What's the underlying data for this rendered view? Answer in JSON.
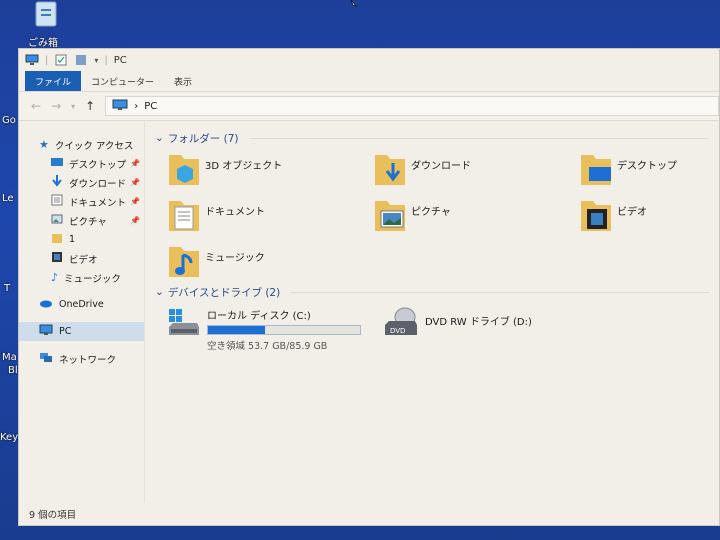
{
  "desktop": {
    "recycle_label": "ごみ箱",
    "side_labels": [
      "Go",
      "Le",
      "T",
      "Ma",
      "Bl",
      "Keyb"
    ]
  },
  "titlebar": {
    "title": "PC"
  },
  "ribbon": {
    "tabs": [
      "ファイル",
      "コンピューター",
      "表示"
    ]
  },
  "address": {
    "path_sep": "›",
    "path": "PC"
  },
  "sidebar": {
    "quick_access": "クイック アクセス",
    "pinned": [
      {
        "label": "デスクトップ",
        "icon": "desktop-icon"
      },
      {
        "label": "ダウンロード",
        "icon": "download-icon"
      },
      {
        "label": "ドキュメント",
        "icon": "documents-icon"
      },
      {
        "label": "ピクチャ",
        "icon": "pictures-icon"
      }
    ],
    "recent": [
      {
        "label": "1",
        "icon": "folder-icon"
      },
      {
        "label": "ビデオ",
        "icon": "videos-icon"
      },
      {
        "label": "ミュージック",
        "icon": "music-icon"
      }
    ],
    "onedrive": "OneDrive",
    "pc": "PC",
    "network": "ネットワーク"
  },
  "folders_section": {
    "title": "フォルダー (7)",
    "items": [
      "3D オブジェクト",
      "ダウンロード",
      "デスクトップ",
      "ドキュメント",
      "ピクチャ",
      "ビデオ",
      "ミュージック"
    ]
  },
  "drives_section": {
    "title": "デバイスとドライブ (2)",
    "local": {
      "name": "ローカル ディスク (C:)",
      "free_text": "空き領域 53.7 GB/85.9 GB",
      "used_fraction": 0.375
    },
    "dvd": {
      "name": "DVD RW ドライブ (D:)"
    }
  },
  "status": {
    "text": "9 個の項目"
  },
  "colors": {
    "accent": "#1a5fb4",
    "selection": "#cfdcec",
    "folder": "#e8bf5a"
  }
}
